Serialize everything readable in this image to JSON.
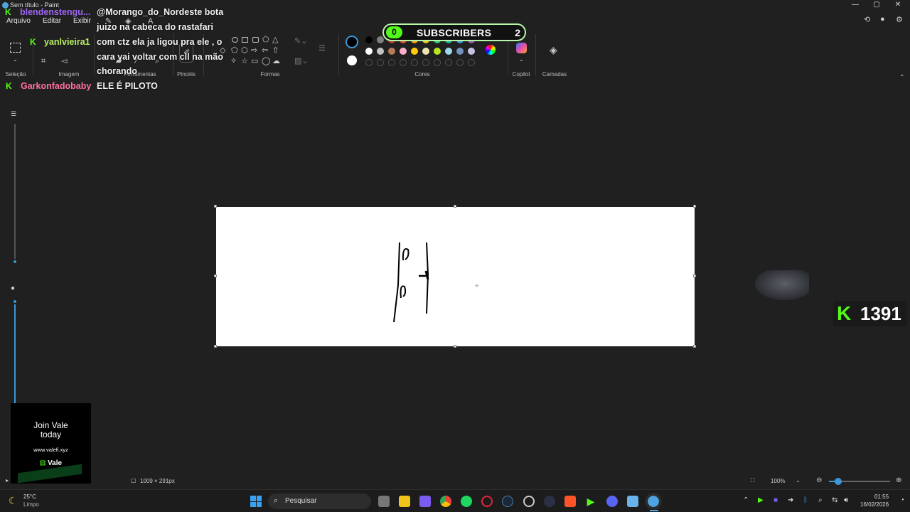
{
  "window": {
    "title": "Sem título - Paint",
    "minimize": "—",
    "maximize": "▢",
    "close": "✕"
  },
  "menu": {
    "items": [
      "Arquivo",
      "Editar",
      "Exibir"
    ]
  },
  "ribbon": {
    "groups": [
      {
        "label": "Seleção"
      },
      {
        "label": "Imagem"
      },
      {
        "label": "Ferramentas"
      },
      {
        "label": "Pincéis"
      },
      {
        "label": "Formas"
      },
      {
        "label": "Cores"
      },
      {
        "label": "Copilot"
      },
      {
        "label": "Camadas"
      }
    ]
  },
  "colors": {
    "row1": [
      "#000000",
      "#7f7f7f",
      "#c0392b",
      "#e74c3c",
      "#f39c12",
      "#f1c40f",
      "#2ecc71",
      "#1abc9c",
      "#3498db",
      "#9b59b6"
    ],
    "row2": [
      "#ffffff",
      "#c3c3c3",
      "#b97a57",
      "#ffaec9",
      "#ffc90e",
      "#efe4b0",
      "#b5e61d",
      "#99d9ea",
      "#7092be",
      "#c8bfe7"
    ],
    "primary": "#000000",
    "secondary": "#ffffff"
  },
  "subscribers": {
    "count_left": "0",
    "label": "SUBSCRIBERS",
    "count_right": "2"
  },
  "chat": [
    {
      "user": "blendenstengu...",
      "user_color": "#9e64f5",
      "message_lines": [
        "@Morango_do_Nordeste bota",
        "juizo na cabeca do rastafari"
      ]
    },
    {
      "user": "yanlvieira1",
      "user_color": "#b7f060",
      "message_lines": [
        "com ctz ela ja ligou pra ele , o",
        "cara vai voltar com cll na mão",
        "chorando"
      ]
    },
    {
      "user": "Garkonfadobaby",
      "user_color": "#ff6fa0",
      "message_lines": [
        "ELE É PILOTO"
      ]
    }
  ],
  "ad": {
    "line1": "Join Vale",
    "line2": "today",
    "url": "www.valefi.xyz",
    "brand": "Vale"
  },
  "kick_counter": {
    "logo": "K",
    "value": "1391"
  },
  "status": {
    "canvas_size": "1009 × 291px",
    "zoom": "100%"
  },
  "taskbar": {
    "weather_temp": "25°C",
    "weather_desc": "Limpo",
    "search_placeholder": "Pesquisar",
    "time": "01:55",
    "date": "16/02/2026"
  }
}
